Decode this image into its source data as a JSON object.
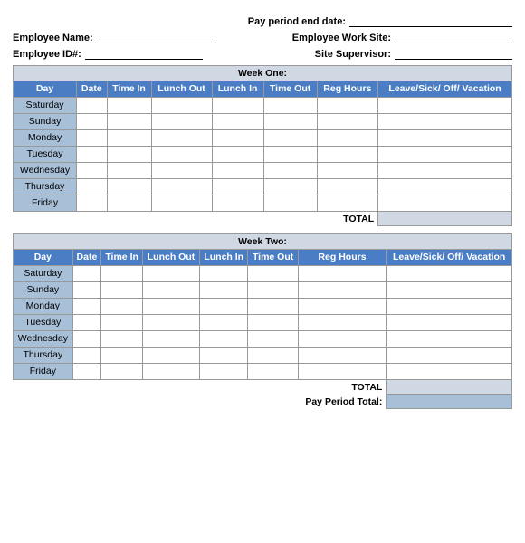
{
  "header": {
    "pay_period_label": "Pay period end date:",
    "employee_name_label": "Employee Name:",
    "employee_work_site_label": "Employee Work Site:",
    "employee_id_label": "Employee ID#:",
    "site_supervisor_label": "Site Supervisor:"
  },
  "week_one": {
    "title": "Week One:",
    "columns": [
      "Day",
      "Date",
      "Time In",
      "Lunch Out",
      "Lunch In",
      "Time Out",
      "Reg Hours",
      "Leave/Sick/ Off/ Vacation"
    ],
    "days": [
      "Saturday",
      "Sunday",
      "Monday",
      "Tuesday",
      "Wednesday",
      "Thursday",
      "Friday"
    ],
    "total_label": "TOTAL"
  },
  "week_two": {
    "title": "Week Two:",
    "columns": [
      "Day",
      "Date",
      "Time In",
      "Lunch Out",
      "Lunch In",
      "Time Out",
      "Reg Hours",
      "Leave/Sick/ Off/ Vacation"
    ],
    "days": [
      "Saturday",
      "Sunday",
      "Monday",
      "Tuesday",
      "Wednesday",
      "Thursday",
      "Friday"
    ],
    "total_label": "TOTAL"
  },
  "pay_period": {
    "label": "Pay Period Total:"
  }
}
